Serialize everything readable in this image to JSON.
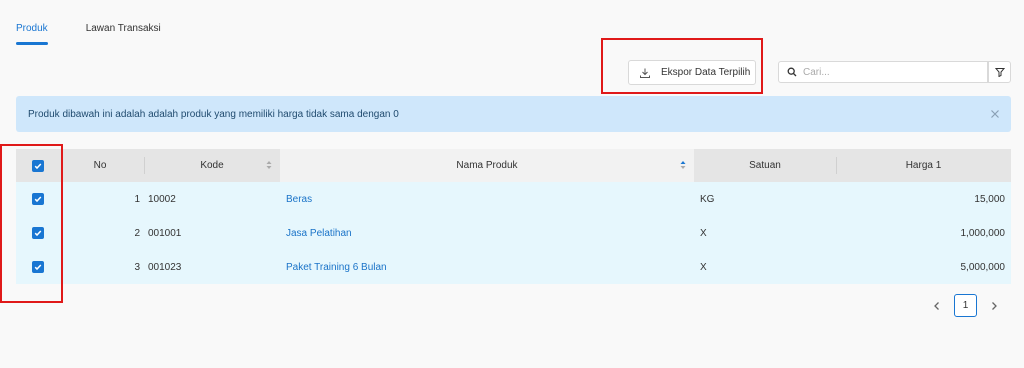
{
  "tabs": [
    {
      "label": "Produk",
      "active": true
    },
    {
      "label": "Lawan Transaksi",
      "active": false
    }
  ],
  "toolbar": {
    "export_label": "Ekspor Data Terpilih",
    "search_placeholder": "Cari..."
  },
  "alert": {
    "message": "Produk dibawah ini adalah adalah produk yang memiliki harga tidak sama dengan 0"
  },
  "table": {
    "columns": [
      "No",
      "Kode",
      "Nama Produk",
      "Satuan",
      "Harga 1"
    ],
    "rows": [
      {
        "no": "1",
        "kode": "10002",
        "nama": "Beras",
        "satuan": "KG",
        "harga": "15,000",
        "checked": true
      },
      {
        "no": "2",
        "kode": "001001",
        "nama": "Jasa Pelatihan",
        "satuan": "X",
        "harga": "1,000,000",
        "checked": true
      },
      {
        "no": "3",
        "kode": "001023",
        "nama": "Paket Training 6 Bulan",
        "satuan": "X",
        "harga": "5,000,000",
        "checked": true
      }
    ]
  },
  "pagination": {
    "current_page": "1"
  },
  "colors": {
    "accent": "#1976d2",
    "highlight": "#e01919",
    "alert_bg": "#cfe7fb",
    "row_bg": "#e6f7fd"
  },
  "icons": [
    "download-icon",
    "search-icon",
    "filter-icon",
    "close-icon",
    "sort-icon",
    "check-icon",
    "chevron-left-icon",
    "chevron-right-icon"
  ]
}
